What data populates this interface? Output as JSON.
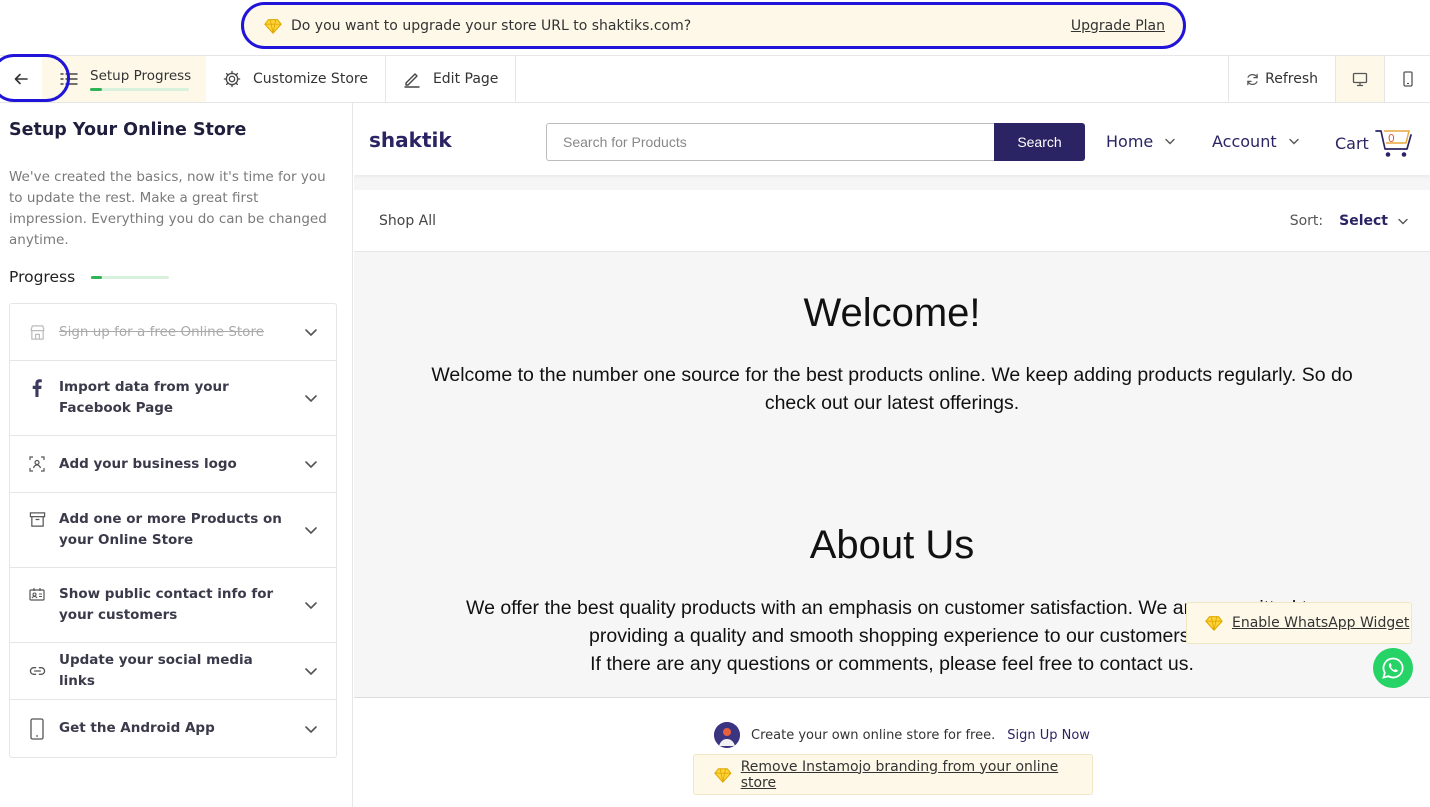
{
  "banner": {
    "message": "Do you want to upgrade your store URL to shaktiks.com?",
    "upgrade_label": "Upgrade Plan",
    "icon": "diamond-icon"
  },
  "toolbar": {
    "back_icon": "arrow-left-icon",
    "setup_progress_label": "Setup Progress",
    "setup_progress_value": 0.12,
    "customize_label": "Customize Store",
    "edit_page_label": "Edit Page",
    "refresh_label": "Refresh",
    "desktop_icon": "desktop-icon",
    "mobile_icon": "mobile-icon"
  },
  "sidebar": {
    "title": "Setup Your Online Store",
    "description": "We've created the basics, now it's time for you to update the rest. Make a great first impression. Everything you do can be changed anytime.",
    "progress_label": "Progress",
    "progress_value": 0.14,
    "steps": [
      {
        "label": "Sign up for a free Online Store",
        "done": true,
        "icon": "store-icon"
      },
      {
        "label": "Import data from your Facebook Page",
        "done": false,
        "icon": "facebook-icon"
      },
      {
        "label": "Add your business logo",
        "done": false,
        "icon": "logo-icon"
      },
      {
        "label": "Add one or more Products on your Online Store",
        "done": false,
        "icon": "box-icon"
      },
      {
        "label": "Show public contact info for your customers",
        "done": false,
        "icon": "contact-card-icon"
      },
      {
        "label": "Update your social media links",
        "done": false,
        "icon": "link-icon"
      },
      {
        "label": "Get the Android App",
        "done": false,
        "icon": "phone-icon"
      }
    ]
  },
  "store": {
    "name": "shaktik",
    "search_placeholder": "Search for Products",
    "search_button": "Search",
    "nav_home": "Home",
    "nav_account": "Account",
    "cart_label": "Cart",
    "cart_count": "0",
    "shop_all": "Shop All",
    "sort_label": "Sort:",
    "sort_value": "Select",
    "welcome_title": "Welcome!",
    "welcome_line1": "Welcome to the number one source for the best products online. We keep adding products regularly. So do",
    "welcome_line2": "check out our latest offerings.",
    "about_title": "About Us",
    "about_line1": "We offer the best quality products with an emphasis on customer satisfaction. We are committed to",
    "about_line2": "providing a quality and smooth shopping experience to our customers.",
    "about_line3": "If there are any questions or comments, please feel free to contact us.",
    "whatsapp_widget": "Enable WhatsApp Widget",
    "footer_text": "Create your own online store for free.",
    "footer_link": "Sign Up Now",
    "branding_text": "Remove Instamojo branding from your online store"
  },
  "colors": {
    "highlight_ring": "#2014d8",
    "brand": "#2b2464",
    "progress": "#2fb356",
    "banner_bg": "#fdf8e8",
    "whatsapp": "#25d366"
  }
}
